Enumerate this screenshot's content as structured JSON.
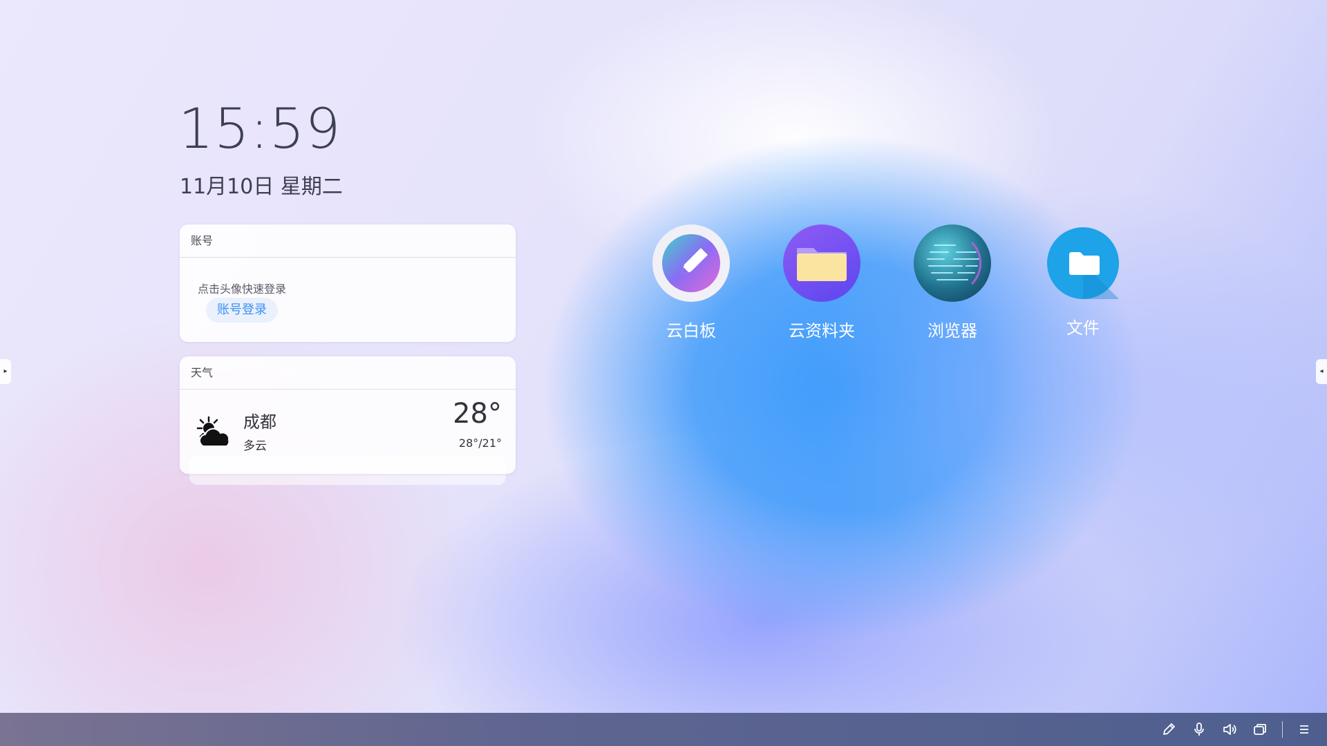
{
  "clock": {
    "time": "15:59",
    "date": "11月10日 星期二"
  },
  "account_widget": {
    "title": "账号",
    "hint": "点击头像快速登录",
    "login_button": "账号登录"
  },
  "weather_widget": {
    "title": "天气",
    "city": "成都",
    "condition": "多云",
    "temperature": "28°",
    "range": "28°/21°",
    "icon": "partly-cloudy-icon"
  },
  "apps": [
    {
      "label": "云白板",
      "icon": "whiteboard-icon",
      "color": "#7b6cf6"
    },
    {
      "label": "云资料夹",
      "icon": "folder-icon",
      "color": "#6a4cf0"
    },
    {
      "label": "浏览器",
      "icon": "globe-icon",
      "color": "#2f7e9c"
    },
    {
      "label": "文件",
      "icon": "files-icon",
      "color": "#1ea2e8"
    }
  ],
  "side_handles": {
    "left": "▸",
    "right": "◂"
  },
  "taskbar": {
    "icons": [
      "pen-icon",
      "microphone-icon",
      "volume-icon",
      "windows-icon",
      "menu-icon"
    ]
  }
}
